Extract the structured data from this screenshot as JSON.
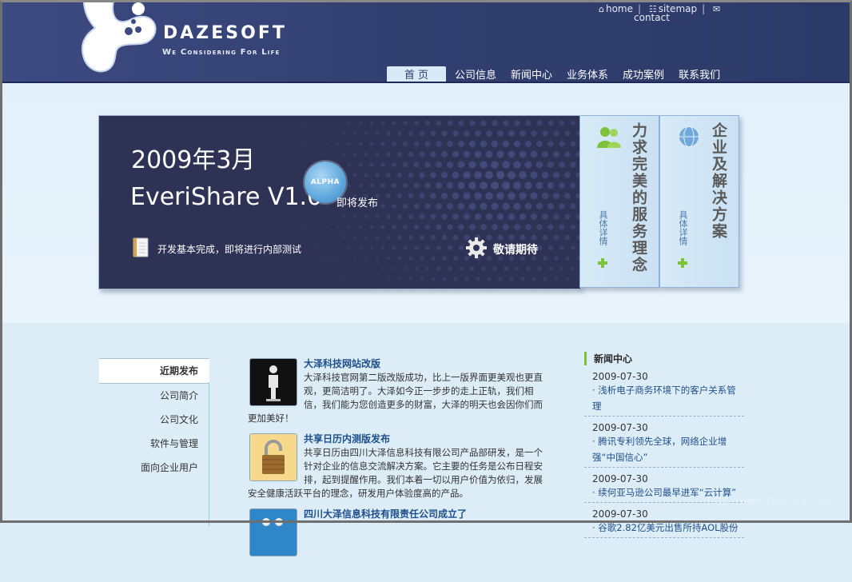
{
  "header": {
    "brand": "DAZESOFT",
    "tagline": "We Considering For Life",
    "links": {
      "home": "home",
      "sitemap": "sitemap",
      "contact": "contact"
    },
    "nav": [
      "首 页",
      "公司信息",
      "新闻中心",
      "业务体系",
      "成功案例",
      "联系我们"
    ]
  },
  "hero": {
    "date": "2009年3月",
    "product": "EveriShare V1.0",
    "badge": "ALPHA",
    "release": "即将发布",
    "status": "开发基本完成，即将进行内部测试",
    "stay_tuned": "敬请期待"
  },
  "panels": [
    {
      "title": "力求完美的服务理念",
      "detail": "具体详情",
      "icon": "people-icon"
    },
    {
      "title": "企业及解决方案",
      "detail": "具体详情",
      "icon": "globe-icon"
    }
  ],
  "leftmenu": {
    "title": "近期发布",
    "items": [
      "公司简介",
      "公司文化",
      "软件与管理",
      "面向企业用户"
    ]
  },
  "news": [
    {
      "title": "大泽科技网站改版",
      "body": "大泽科技官网第二版改版成功，比上一版界面更美观也更直观，更简洁明了。大泽如今正一步步的走上正轨，我们相信，我们能为您创造更多的财富，大泽的明天也会因你们而更加美好！",
      "icon": "person-silhouette-icon"
    },
    {
      "title": "共享日历内测版发布",
      "body": "共享日历由四川大泽信息科技有限公司产品部研发，是一个针对企业的信息交流解决方案。它主要的任务是公布日程安排，起到提醒作用。我们本着一切以用户价值为依归，发展安全健康活跃平台的理念，研发用户体验度高的产品。",
      "icon": "padlock-icon"
    },
    {
      "title": "四川大泽信息科技有限责任公司成立了",
      "body": "",
      "icon": "chart-icon"
    }
  ],
  "rightnews": {
    "title": "新闻中心",
    "items": [
      {
        "date": "2009-07-30",
        "text": "· 浅析电子商务环境下的客户关系管理"
      },
      {
        "date": "2009-07-30",
        "text": "· 腾讯专利领先全球，网络企业增强“中国信心”"
      },
      {
        "date": "2009-07-30",
        "text": "· 续何亚马逊公司最早进军“云计算”"
      },
      {
        "date": "2009-07-30",
        "text": "· 谷歌2.82亿美元出售所持AOL股份"
      }
    ]
  },
  "watermark": "http://www.taskcity.com",
  "colors": {
    "header": "#324071",
    "hero": "#2e3356",
    "background": "#dcedf8",
    "accent": "#7cc23a",
    "link": "#1f4f8a"
  }
}
